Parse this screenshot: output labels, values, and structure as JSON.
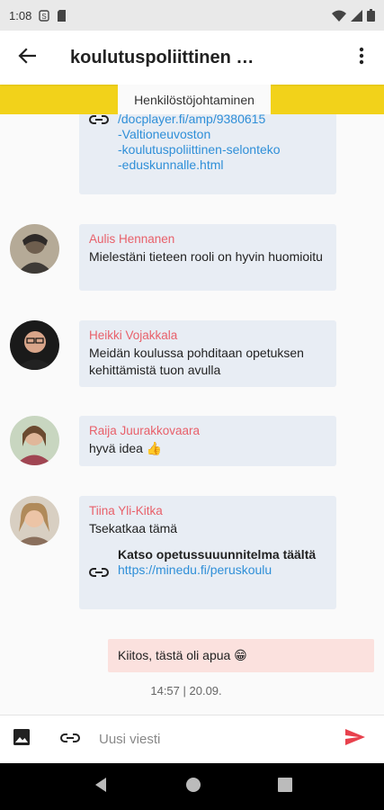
{
  "status_bar": {
    "time": "1:08",
    "icons": [
      "signal-s-icon",
      "sim-card-icon",
      "wifi-icon",
      "cell-signal-icon",
      "battery-icon"
    ]
  },
  "app_bar": {
    "title": "koulutuspoliittinen …",
    "back_icon": "arrow-back-icon",
    "menu_icon": "more-vert-icon"
  },
  "topic": {
    "label": "Henkilöstöjohtaminen",
    "color": "#f2d21a"
  },
  "messages": [
    {
      "link_url": "/docplayer.fi/amp/9380615\n-Valtioneuvoston\n-koulutuspoliittinen-selonteko\n-eduskunnalle.html"
    },
    {
      "sender": "Aulis Hennanen",
      "text": "Mielestäni tieteen rooli on hyvin huomioitu"
    },
    {
      "sender": "Heikki Vojakkala",
      "text": "Meidän koulussa pohditaan opetuksen kehittämistä tuon avulla"
    },
    {
      "sender": "Raija Juurakkovaara",
      "text": "hyvä idea 👍"
    },
    {
      "sender": "Tiina Yli-Kitka",
      "text": "Tsekatkaa tämä",
      "link_title": "Katso opetussuuunnitelma täältä",
      "link_url": "https://minedu.fi/peruskoulu"
    }
  ],
  "own_message": {
    "text": "Kiitos, tästä oli apua 😁",
    "timestamp": "14:57 | 20.09."
  },
  "input_bar": {
    "placeholder": "Uusi viesti",
    "send_color": "#e8414d"
  },
  "colors": {
    "sender_name": "#e8606a",
    "bubble": "#e8edf4",
    "own_bubble": "#fbe1de",
    "link": "#2f8fd8"
  }
}
